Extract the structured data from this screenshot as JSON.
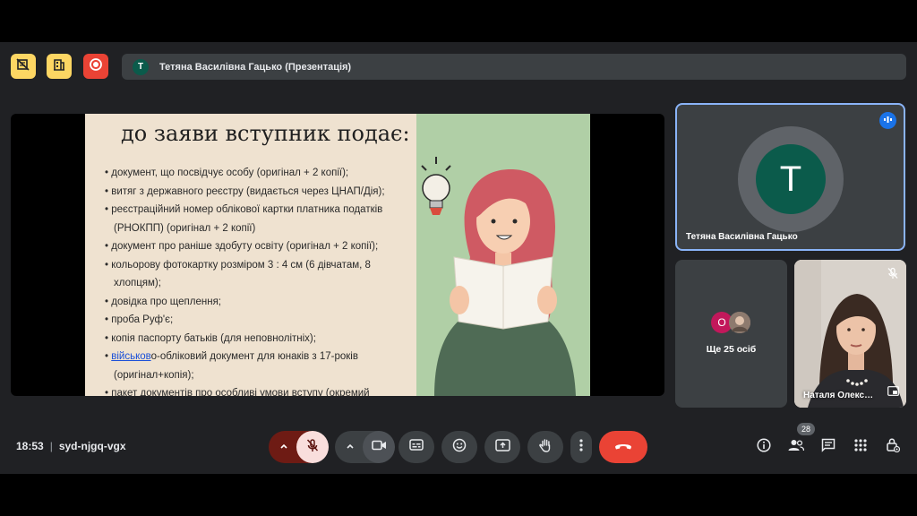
{
  "window": {
    "title": "Тетяна Василівна Гацько (Презентація)",
    "title_avatar_initial": "T"
  },
  "slide": {
    "title": "до заяви вступник подає:",
    "bullets": [
      "документ, що посвідчує особу (оригінал + 2 копії);",
      "витяг з державного реєстру (видається через ЦНАП/Дія);",
      "реєстраційний номер облікової картки платника податків (РНОКПП) (оригінал + 2 копії)",
      "документ про раніше здобуту освіту (оригінал + 2 копії);",
      "кольорову фотокартку розміром 3 : 4 см (6 дівчатам, 8 хлопцям);",
      "довідка про щеплення;",
      "проба Руф'є;",
      "копія паспорту батьків (для неповнолітніх);"
    ],
    "bullet_link_word": "військов",
    "bullet_link_rest": "о-обліковий документ для юнаків з 17-років (оригінал+копія);",
    "bullet_last": "пакет документів про особливі умови вступу (окремий"
  },
  "participants": {
    "main": {
      "name": "Тетяна Василівна Гацько",
      "initial": "T"
    },
    "others": {
      "label": "Ще 25 осіб",
      "avatar_initial": "O"
    },
    "video": {
      "name": "Наталя Олекс…"
    }
  },
  "meeting": {
    "time": "18:53",
    "separator": "|",
    "code": "syd-njgq-vgx",
    "people_count": "28"
  },
  "colors": {
    "accent": "#8ab4f8",
    "hangup": "#ea4335",
    "mic_off": "#f9dedc",
    "record": "#ea4335",
    "warning": "#fdd663"
  },
  "icons": [
    "no-camera-icon",
    "building-icon",
    "record-icon",
    "speaking-icon",
    "mic-off-icon",
    "chevron-up-icon",
    "camera-icon",
    "captions-icon",
    "emoji-icon",
    "present-icon",
    "hand-icon",
    "more-icon",
    "hangup-icon",
    "info-icon",
    "people-icon",
    "chat-icon",
    "activities-icon",
    "host-controls-icon"
  ]
}
